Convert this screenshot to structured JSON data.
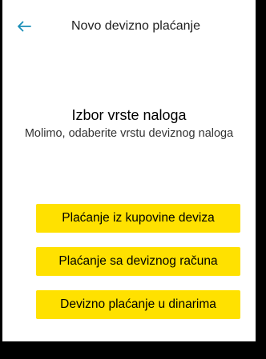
{
  "header": {
    "title": "Novo devizno plaćanje",
    "back_icon": "arrow-left-icon",
    "accent_color": "#1a8fb8"
  },
  "selection": {
    "title": "Izbor vrste naloga",
    "subtitle": "Molimo, odaberite vrstu deviznog naloga"
  },
  "options": [
    {
      "label": "Plaćanje iz kupovine deviza"
    },
    {
      "label": "Plaćanje sa deviznog računa"
    },
    {
      "label": "Devizno plaćanje u dinarima"
    }
  ],
  "colors": {
    "button_background": "#ffe100",
    "page_background": "#ffffff",
    "frame": "#000000"
  }
}
